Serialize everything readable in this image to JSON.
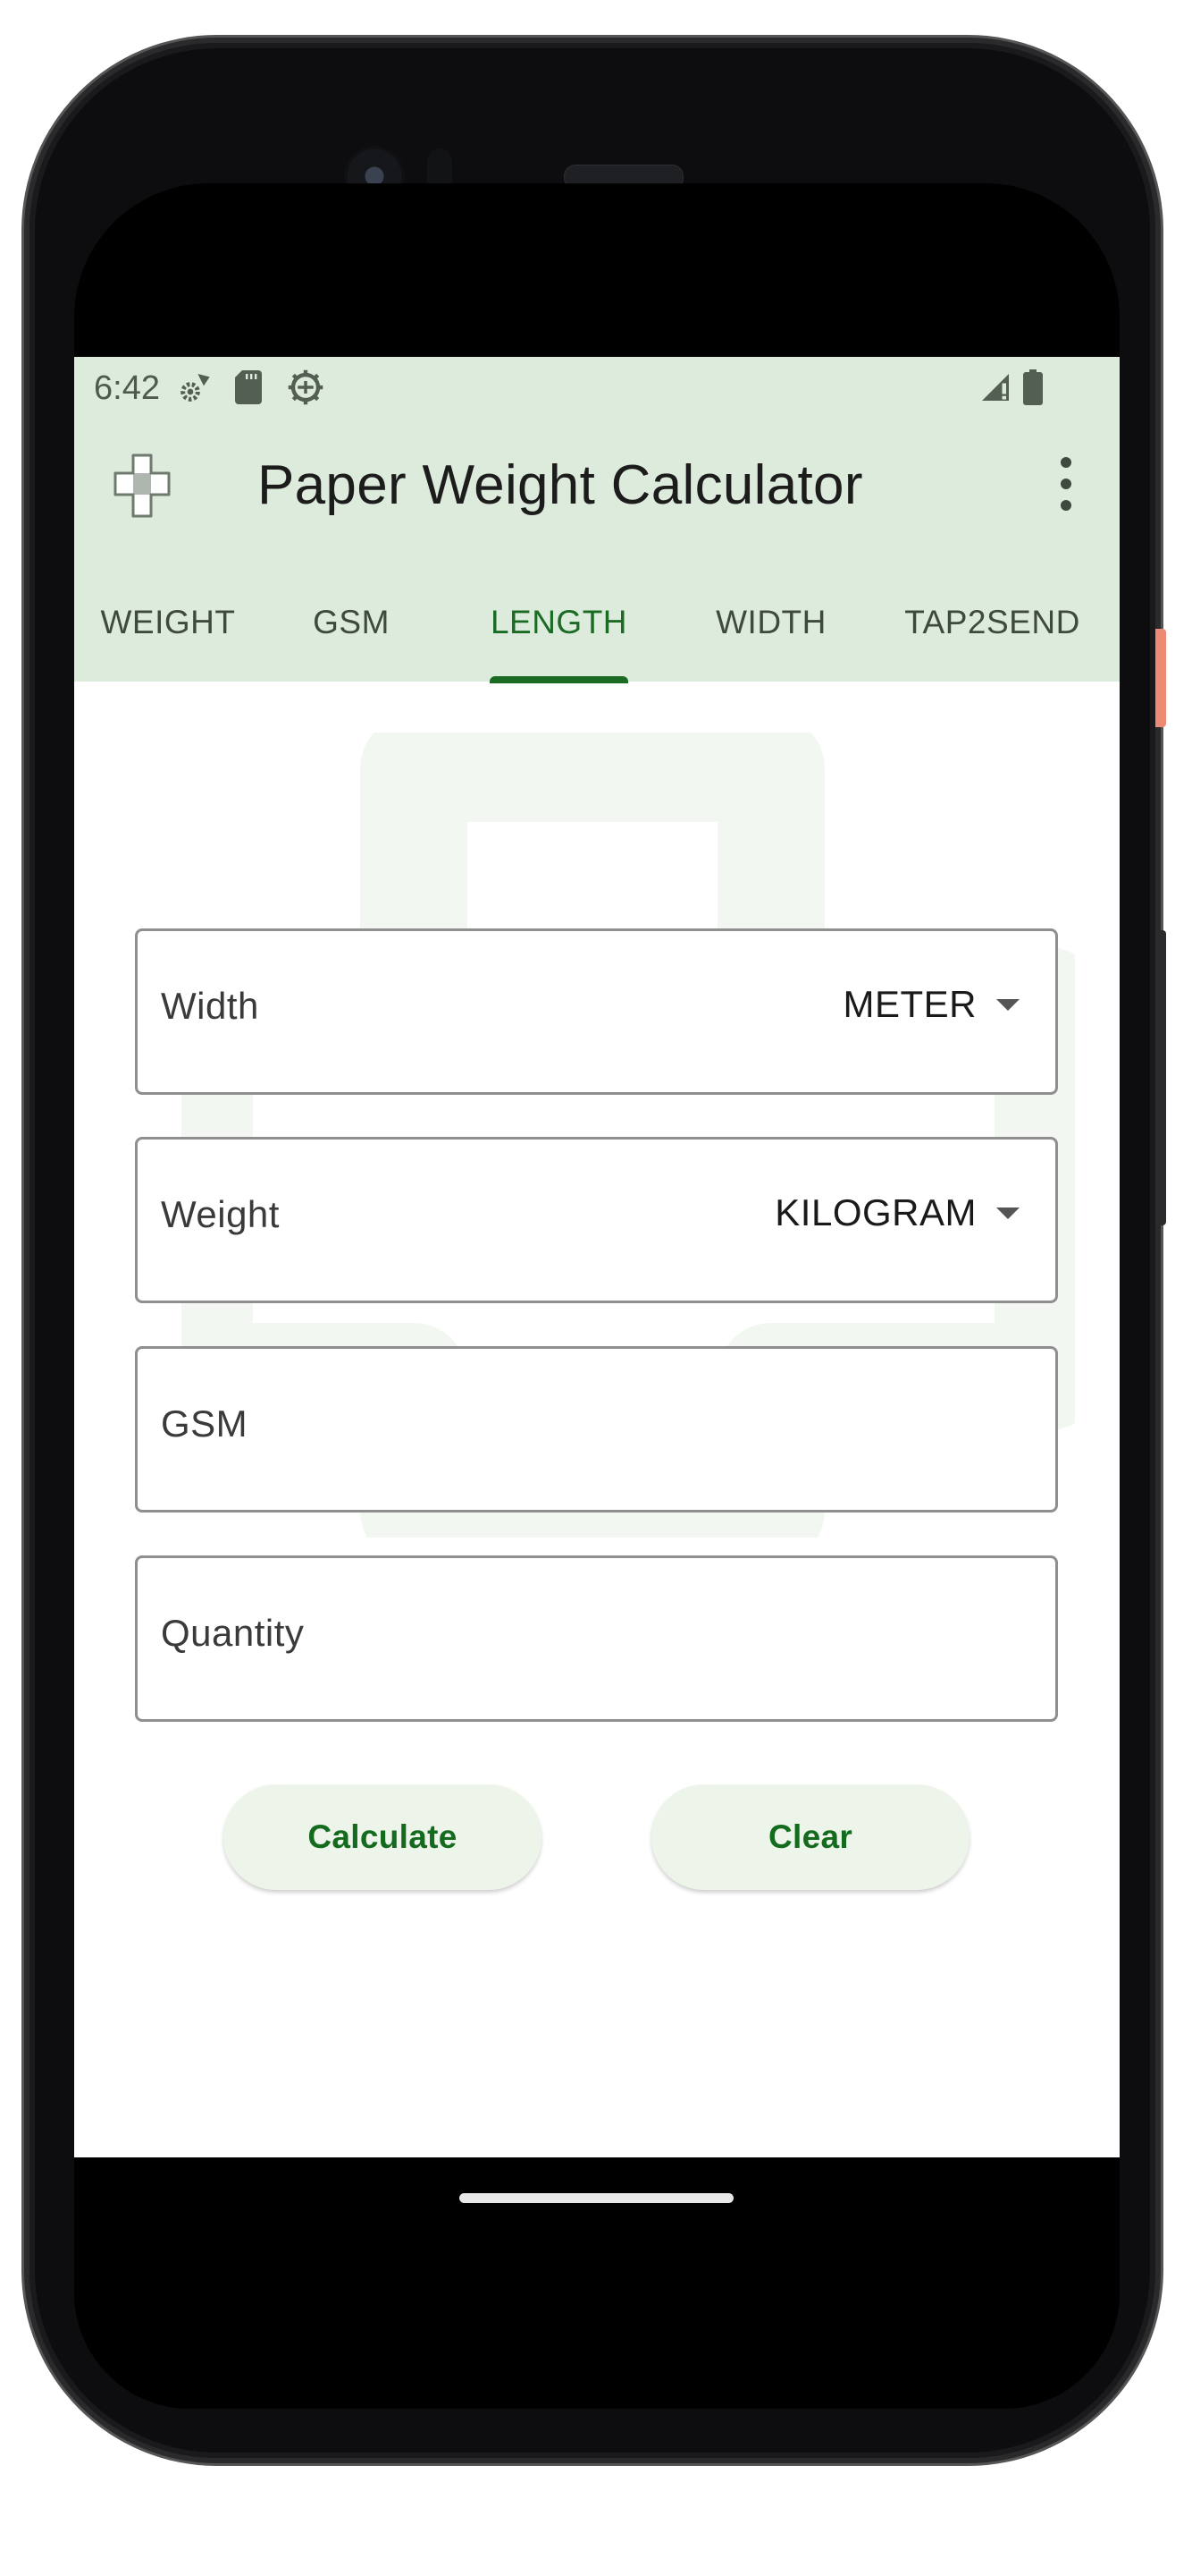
{
  "status_bar": {
    "time": "6:42",
    "left_icons": [
      "settings-gear-small-icon",
      "sd-card-icon",
      "debug-android-icon"
    ],
    "right_icons": [
      "signal-no-service-icon",
      "battery-icon"
    ]
  },
  "toolbar": {
    "app_icon": "puzzle-cross-logo-icon",
    "title": "Paper Weight Calculator",
    "overflow_icon": "more-vert-icon"
  },
  "tabs": [
    {
      "label": "WEIGHT",
      "active": false
    },
    {
      "label": "GSM",
      "active": false
    },
    {
      "label": "LENGTH",
      "active": true
    },
    {
      "label": "WIDTH",
      "active": false
    },
    {
      "label": "TAP2SEND",
      "active": false
    }
  ],
  "form": {
    "fields": [
      {
        "label": "Width",
        "unit": "METER",
        "has_dropdown": true
      },
      {
        "label": "Weight",
        "unit": "KILOGRAM",
        "has_dropdown": true
      },
      {
        "label": "GSM",
        "unit": null,
        "has_dropdown": false
      },
      {
        "label": "Quantity",
        "unit": null,
        "has_dropdown": false
      }
    ],
    "calculate_label": "Calculate",
    "clear_label": "Clear"
  },
  "colors": {
    "header_bg": "#dcebdb",
    "accent": "#1b6b25",
    "button_bg": "#edf4ea",
    "side_button": "#ec8a76"
  }
}
